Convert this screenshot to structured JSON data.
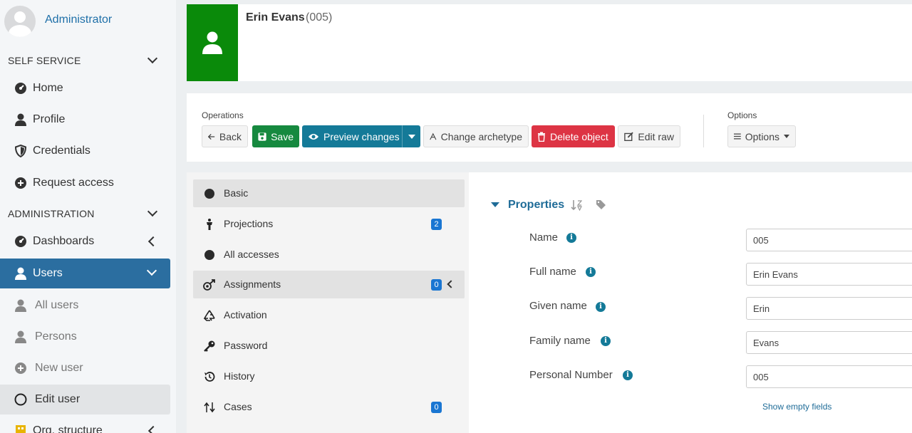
{
  "sidebar": {
    "user_name": "Administrator",
    "self_service_title": "SELF SERVICE",
    "self_service_items": [
      {
        "label": "Home",
        "icon": "dashboard-icon"
      },
      {
        "label": "Profile",
        "icon": "user-icon"
      },
      {
        "label": "Credentials",
        "icon": "shield-icon"
      },
      {
        "label": "Request access",
        "icon": "plus-circle-icon"
      }
    ],
    "administration_title": "ADMINISTRATION",
    "admin_items": [
      {
        "label": "Dashboards",
        "icon": "dashboard-icon"
      },
      {
        "label": "Users",
        "icon": "user-icon"
      },
      {
        "label": "All users",
        "icon": "user-icon"
      },
      {
        "label": "Persons",
        "icon": "user-icon"
      },
      {
        "label": "New user",
        "icon": "plus-circle-icon"
      },
      {
        "label": "Edit user",
        "icon": "circle-outline-icon"
      },
      {
        "label": "Org. structure",
        "icon": "building-icon"
      }
    ]
  },
  "header": {
    "name": "Erin Evans",
    "oid": "(005)",
    "photo_color": "#0a8a0a"
  },
  "operations": {
    "title": "Operations",
    "back": "Back",
    "save": "Save",
    "preview": "Preview changes",
    "change_archetype": "Change archetype",
    "delete": "Delete object",
    "edit_raw": "Edit raw",
    "options_title": "Options",
    "options": "Options"
  },
  "tabs": [
    {
      "label": "Basic",
      "icon": "circle-icon",
      "badge": ""
    },
    {
      "label": "Projections",
      "icon": "person-standing-icon",
      "badge": "2"
    },
    {
      "label": "All accesses",
      "icon": "circle-icon",
      "badge": ""
    },
    {
      "label": "Assignments",
      "icon": "assignment-icon",
      "badge": "0"
    },
    {
      "label": "Activation",
      "icon": "recycle-icon",
      "badge": ""
    },
    {
      "label": "Password",
      "icon": "key-icon",
      "badge": ""
    },
    {
      "label": "History",
      "icon": "history-icon",
      "badge": ""
    },
    {
      "label": "Cases",
      "icon": "cases-icon",
      "badge": "0"
    }
  ],
  "properties": {
    "title": "Properties",
    "fields": [
      {
        "label": "Name",
        "value": "005"
      },
      {
        "label": "Full name",
        "value": "Erin Evans"
      },
      {
        "label": "Given name",
        "value": "Erin"
      },
      {
        "label": "Family name",
        "value": "Evans"
      },
      {
        "label": "Personal Number",
        "value": "005"
      }
    ],
    "show_empty": "Show empty fields"
  },
  "colors": {
    "accent": "#2b6ea0",
    "save": "#16893f",
    "preview": "#147a98",
    "delete": "#dd3444"
  }
}
